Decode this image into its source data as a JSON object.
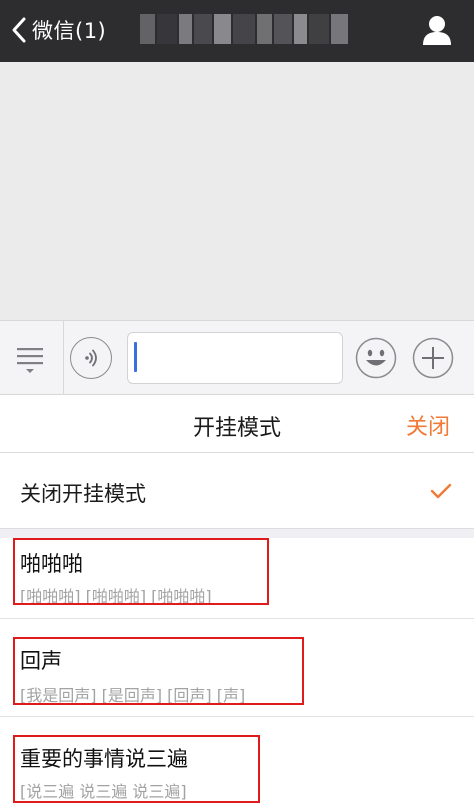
{
  "topbar": {
    "back_label": "微信(1)",
    "title_blocks": [
      "#6d6d70",
      "#3a3a3d",
      "#8a8a8d",
      "#505053",
      "#9a9a9d",
      "#4a4a4d",
      "#7c7c7f",
      "#5c5c5f",
      "#9c9c9f",
      "#444447",
      "#858588"
    ],
    "profile_icon": "person-icon"
  },
  "input_bar": {
    "menu_icon": "list-menu-icon",
    "voice_icon": "voice-icon",
    "text_value": "",
    "emoji_icon": "emoji-icon",
    "plus_icon": "plus-icon"
  },
  "panel": {
    "title": "开挂模式",
    "close_label": "关闭"
  },
  "off_option": {
    "label": "关闭开挂模式",
    "selected_icon": "checkmark-icon"
  },
  "modes": [
    {
      "name": "啪啪啪",
      "sample": "[啪啪啪] [啪啪啪] [啪啪啪]"
    },
    {
      "name": "回声",
      "sample": "[我是回声] [是回声] [回声] [声]"
    },
    {
      "name": "重要的事情说三遍",
      "sample": "[说三遍 说三遍 说三遍]"
    }
  ],
  "colors": {
    "topbar": "#2d2d30",
    "chat_bg": "#ebebeb",
    "accent": "#f07a35",
    "caret": "#3b6fe0",
    "highlight": "#e01b1b"
  }
}
